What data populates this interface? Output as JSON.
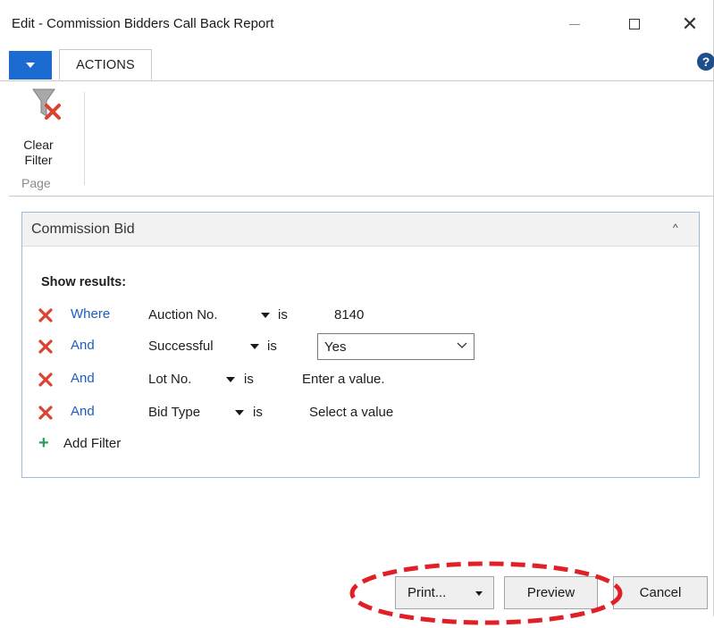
{
  "window": {
    "title": "Edit - Commission Bidders Call Back Report",
    "close_glyph": "✕"
  },
  "ribbon": {
    "tab_label": "ACTIONS",
    "help_glyph": "?",
    "clear_filter_label_line1": "Clear",
    "clear_filter_label_line2": "Filter",
    "group_label": "Page"
  },
  "panel": {
    "title": "Commission Bid",
    "collapse_glyph": "^",
    "show_results_label": "Show results:",
    "filters": [
      {
        "conjunction": "Where",
        "field": "Auction No.",
        "operator": "is",
        "value": "8140"
      },
      {
        "conjunction": "And",
        "field": "Successful",
        "operator": "is",
        "value": "Yes"
      },
      {
        "conjunction": "And",
        "field": "Lot No.",
        "operator": "is",
        "value": "Enter a value."
      },
      {
        "conjunction": "And",
        "field": "Bid Type",
        "operator": "is",
        "value": "Select a value"
      }
    ],
    "add_filter_label": "Add Filter"
  },
  "footer": {
    "print_label": "Print...",
    "preview_label": "Preview",
    "cancel_label": "Cancel"
  },
  "colors": {
    "accent_blue": "#1c6bd1",
    "link_blue": "#1b5ebf",
    "remove_red": "#d9432f",
    "add_green": "#2e9e5b",
    "highlight_red": "#e01f26"
  },
  "icons": {
    "app_menu": "caret-down-icon",
    "clear_filter": "funnel-clear-icon",
    "remove_filter": "red-x-icon",
    "add_filter": "plus-icon"
  }
}
